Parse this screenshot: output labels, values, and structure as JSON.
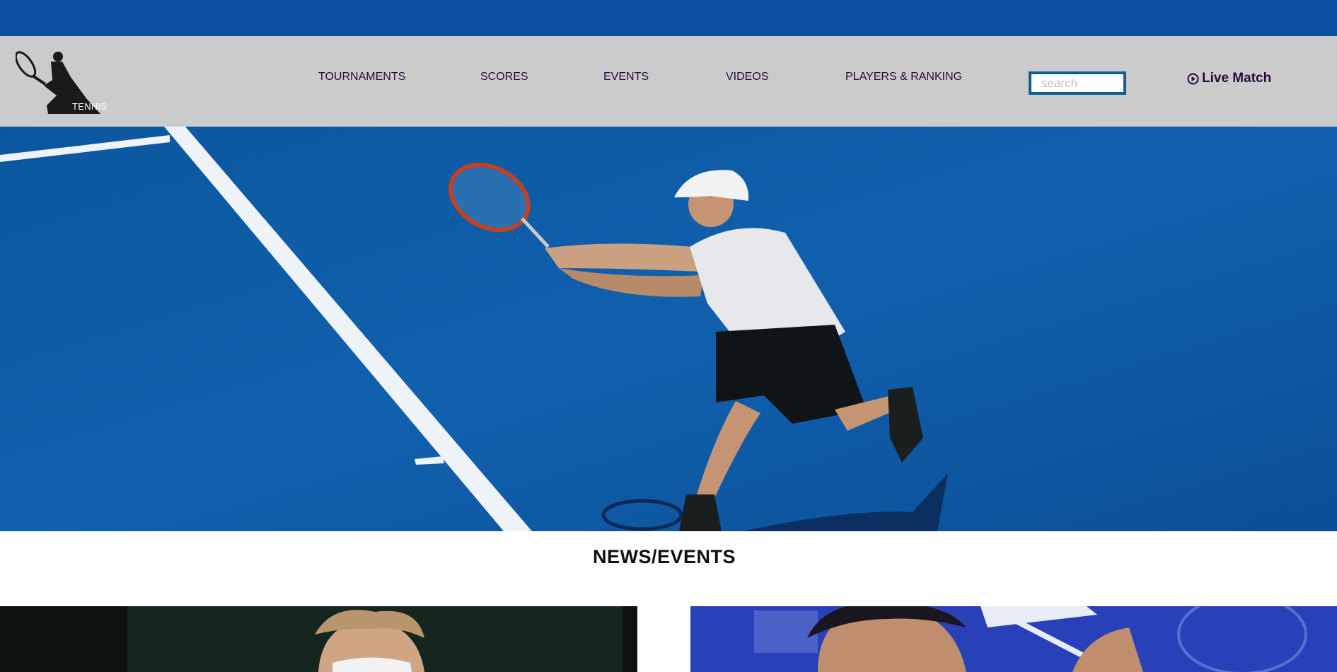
{
  "header": {
    "logo_text": "TENNIS",
    "nav": [
      {
        "label": "TOURNAMENTS"
      },
      {
        "label": "SCORES"
      },
      {
        "label": "EVENTS"
      },
      {
        "label": "VIDEOS"
      },
      {
        "label": "PLAYERS & RANKING"
      }
    ],
    "search": {
      "placeholder": "search",
      "value": ""
    },
    "live_match_label": "Live Match",
    "live_match_icon": "play-circle-icon"
  },
  "news": {
    "title": "NEWS/EVENTS"
  },
  "colors": {
    "top_bar": "#0c4ea0",
    "nav_background": "#cbcbcb",
    "nav_text": "#2a0a3a",
    "search_border": "#0e5e8f",
    "court": "#0e5aa8"
  }
}
